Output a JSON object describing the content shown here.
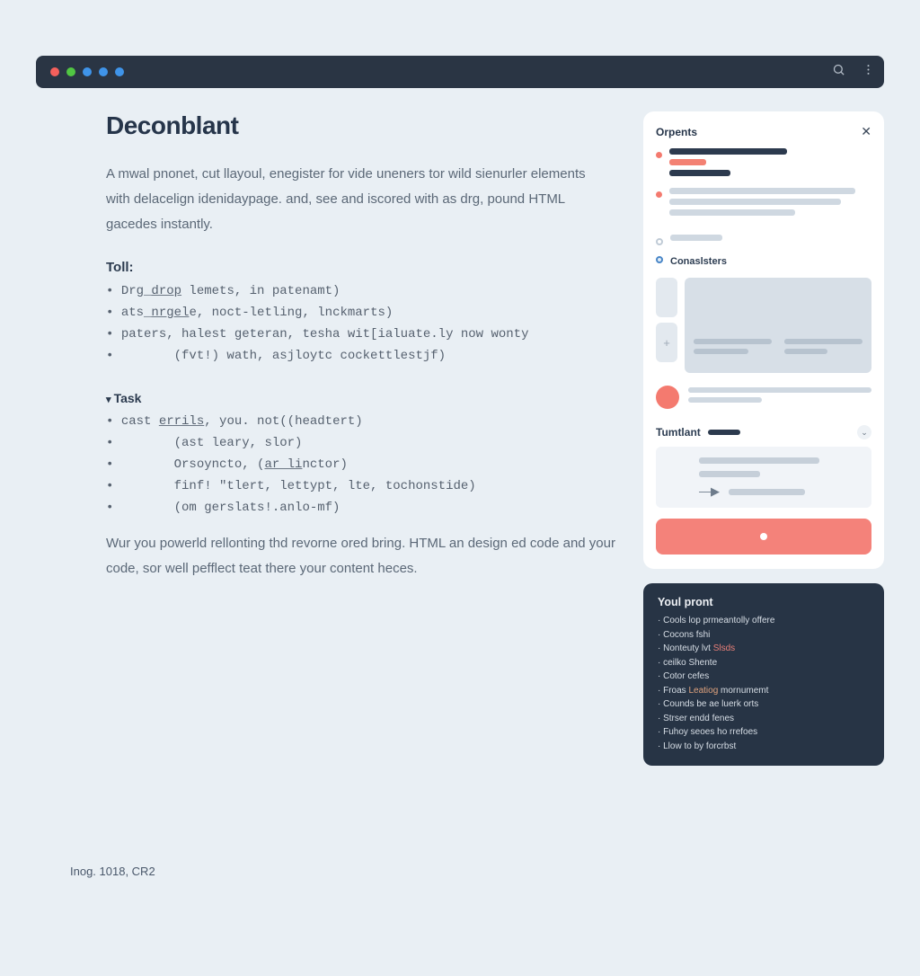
{
  "main": {
    "title": "Deconblant",
    "intro": "A mwal pnonet, cut llayoul, enegister for vide uneners tor wild sienurler elements with delacelign idenidaypage. and, see and iscored with as drg, pound HTML gacedes instantly.",
    "toll_heading": "Toll:",
    "toll_items": [
      {
        "text": "Drg_drop lemets, in patenamt)",
        "underline": "drop"
      },
      {
        "text": "ats_nrgele, noct-letling, lnckmarts)",
        "underline": "nrgel"
      },
      {
        "text": "paters, halest geteran, tesha wit[ialuate.ly now wonty"
      },
      {
        "indent": "(fvt!) wath, asjloytc cockettlestjf)"
      }
    ],
    "task_heading": "Task",
    "task_items": [
      {
        "text": "cast errils, you. not((headtert)",
        "underline": "errils"
      },
      {
        "indent": "(ast leary, slor)"
      },
      {
        "indent": "Orsoyncto, (ar linctor)",
        "underline": "ar li"
      },
      {
        "indent": "finf! \"tlert, lettypt, lte, tochonstide)"
      },
      {
        "indent": "(om gerslats!.anlo-mf)"
      }
    ],
    "closing": "Wur you powerld rellonting thd revorne ored bring. HTML an design ed code and your code, sor well pefflect teat there your content heces.",
    "footer": "Inog. 1018, CR2"
  },
  "panel": {
    "title": "Orpents",
    "consists_label": "Conaslsters",
    "tumtlant_label": "Tumtlant"
  },
  "promo": {
    "title": "Youl pront",
    "items": [
      "Cools lop prmeantolly offere",
      "Cocons fshi",
      {
        "pre": "Nonteuty lvt ",
        "hi": "Slsds",
        "cls": "hi-red"
      },
      "   ceilko Shente",
      "Cotor cefes",
      {
        "pre": "Froas ",
        "hi": "Leatiog",
        "post": " mornumemt",
        "cls": "hi-org"
      },
      "Counds be ae luerk orts",
      "Strser endd fenes",
      "Fuhoy seoes ho rrefoes",
      "Llow to by forcrbst"
    ]
  }
}
